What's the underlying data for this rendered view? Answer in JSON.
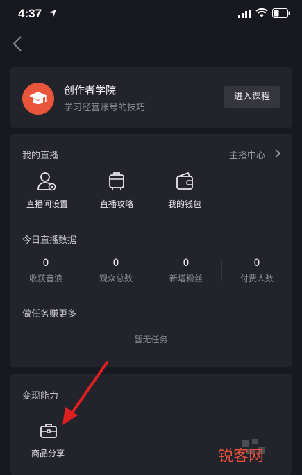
{
  "status_bar": {
    "time": "4:37"
  },
  "academy": {
    "title": "创作者学院",
    "subtitle": "学习经营账号的技巧",
    "enter_label": "进入课程"
  },
  "live": {
    "section_title": "我的直播",
    "host_center_label": "主播中心",
    "items": [
      {
        "label": "直播间设置",
        "icon": "user-settings-icon"
      },
      {
        "label": "直播攻略",
        "icon": "luggage-icon"
      },
      {
        "label": "我的钱包",
        "icon": "wallet-icon"
      }
    ],
    "today_title": "今日直播数据",
    "stats": [
      {
        "value": "0",
        "label": "收获音浪"
      },
      {
        "value": "0",
        "label": "观众总数"
      },
      {
        "value": "0",
        "label": "新增粉丝"
      },
      {
        "value": "0",
        "label": "付费人数"
      }
    ],
    "task_title": "做任务赚更多",
    "no_task": "暂无任务"
  },
  "monetize": {
    "section_title": "变现能力",
    "items": [
      {
        "label": "商品分享",
        "icon": "briefcase-icon"
      }
    ]
  },
  "watermark": {
    "text": "锐客网"
  },
  "colors": {
    "background": "#171820",
    "card": "#22232b",
    "accent": "#e9553a",
    "arrow": "#e02020"
  }
}
